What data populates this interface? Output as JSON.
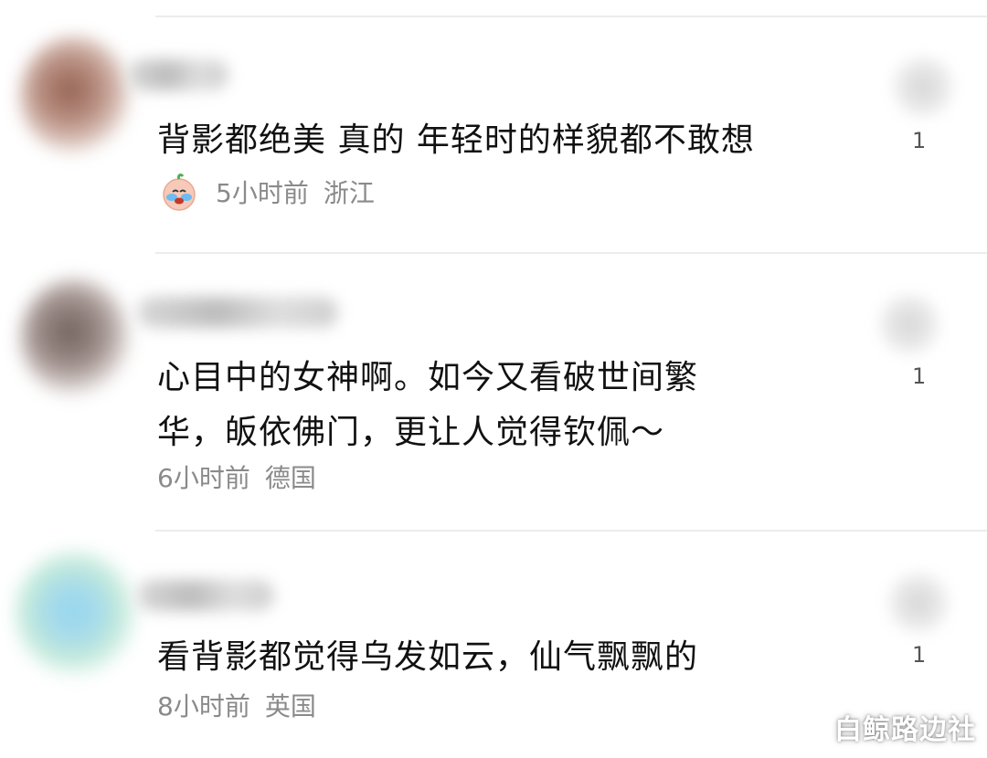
{
  "comments": [
    {
      "text_lines": [
        "背影都绝美 真的 年轻时的样貌都不敢想"
      ],
      "time": "5小时前",
      "location": "浙江",
      "likes": "1",
      "sticker": "crying-baby-sticker-icon"
    },
    {
      "text_lines": [
        "心目中的女神啊。如今又看破世间繁",
        "华，皈依佛门，更让人觉得钦佩～"
      ],
      "time": "6小时前",
      "location": "德国",
      "likes": "1"
    },
    {
      "text_lines": [
        "看背影都觉得乌发如云，仙气飘飘的"
      ],
      "time": "8小时前",
      "location": "英国",
      "likes": "1"
    }
  ],
  "watermark": "白鲸路边社",
  "colors": {
    "text": "#111111",
    "meta": "#8a8a8a",
    "divider": "#ececec"
  }
}
